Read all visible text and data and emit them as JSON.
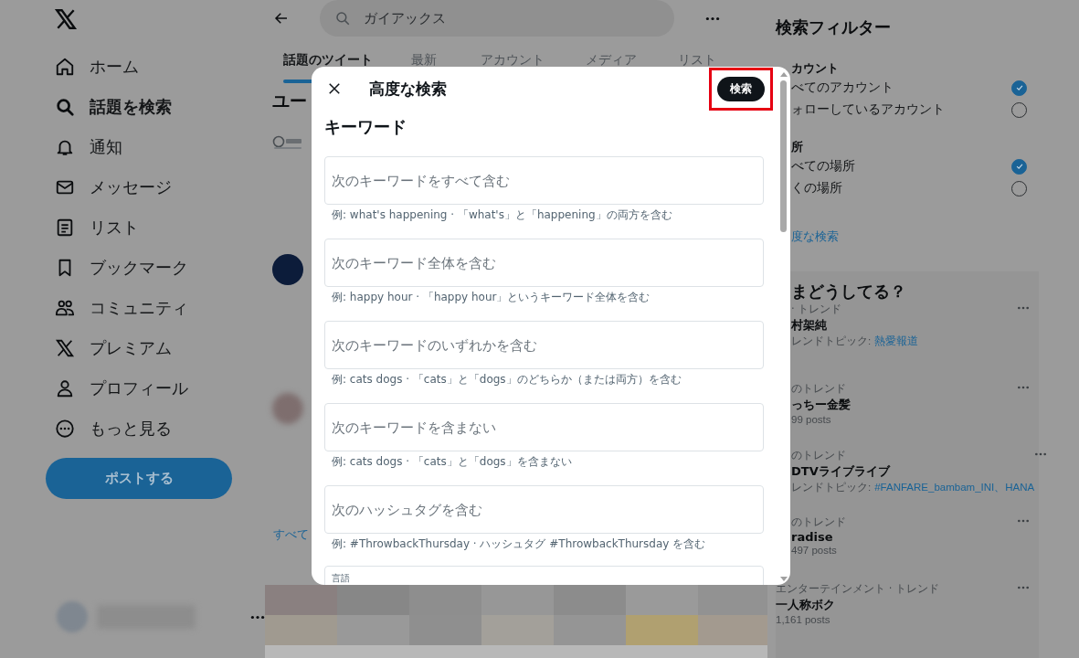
{
  "sidebar": {
    "items": [
      {
        "label": "ホーム",
        "selected": false
      },
      {
        "label": "話題を検索",
        "selected": true
      },
      {
        "label": "通知",
        "selected": false
      },
      {
        "label": "メッセージ",
        "selected": false
      },
      {
        "label": "リスト",
        "selected": false
      },
      {
        "label": "ブックマーク",
        "selected": false
      },
      {
        "label": "コミュニティ",
        "selected": false
      },
      {
        "label": "プレミアム",
        "selected": false
      },
      {
        "label": "プロフィール",
        "selected": false
      },
      {
        "label": "もっと見る",
        "selected": false
      }
    ],
    "post_button": "ポストする"
  },
  "search": {
    "value": "ガイアックス"
  },
  "tabs": [
    {
      "label": "話題のツイート",
      "selected": true
    },
    {
      "label": "最新",
      "selected": false
    },
    {
      "label": "アカウント",
      "selected": false
    },
    {
      "label": "メディア",
      "selected": false
    },
    {
      "label": "リスト",
      "selected": false
    }
  ],
  "results": {
    "heading": "ユー",
    "link": "すべて"
  },
  "filters": {
    "title": "検索フィルター",
    "groups": [
      {
        "heading": "カウント",
        "options": [
          {
            "label": "べてのアカウント",
            "checked": true
          },
          {
            "label": "ォローしているアカウント",
            "checked": false
          }
        ]
      },
      {
        "heading": "所",
        "options": [
          {
            "label": "べての場所",
            "checked": true
          },
          {
            "label": "くの場所",
            "checked": false
          }
        ]
      }
    ],
    "link": "度な検索"
  },
  "trends": {
    "title": "まどうしてる？",
    "items": [
      {
        "context": "· トレンド",
        "name": "村架純",
        "kind": "topic",
        "detail": "レンドトピック:",
        "topic": "熱愛報道"
      },
      {
        "context": "のトレンド",
        "name": "っちー金髪",
        "kind": "count",
        "detail": "99 posts"
      },
      {
        "context": "のトレンド",
        "name": "DTVライブライブ",
        "kind": "topic",
        "detail": "レンドトピック:",
        "topic": "#FANFARE_bambam_INI、HANA"
      },
      {
        "context": "のトレンド",
        "name": "radise",
        "kind": "count",
        "detail": "497 posts"
      },
      {
        "context": "エンターテインメント · トレンド",
        "name": "一人称ボク",
        "kind": "count",
        "detail": "1,161 posts"
      }
    ]
  },
  "modal": {
    "title": "高度な検索",
    "submit": "検索",
    "section": "キーワード",
    "fields": [
      {
        "placeholder": "次のキーワードをすべて含む",
        "hint": "例: what's happening · 「what's」と「happening」の両方を含む"
      },
      {
        "placeholder": "次のキーワード全体を含む",
        "hint": "例: happy hour · 「happy hour」というキーワード全体を含む"
      },
      {
        "placeholder": "次のキーワードのいずれかを含む",
        "hint": "例: cats dogs · 「cats」と「dogs」のどちらか（または両方）を含む"
      },
      {
        "placeholder": "次のキーワードを含まない",
        "hint": "例: cats dogs · 「cats」と「dogs」を含まない"
      },
      {
        "placeholder": "次のハッシュタグを含む",
        "hint": "例: #ThrowbackThursday · ハッシュタグ #ThrowbackThursday を含む"
      }
    ],
    "next_field_label": "言語"
  }
}
